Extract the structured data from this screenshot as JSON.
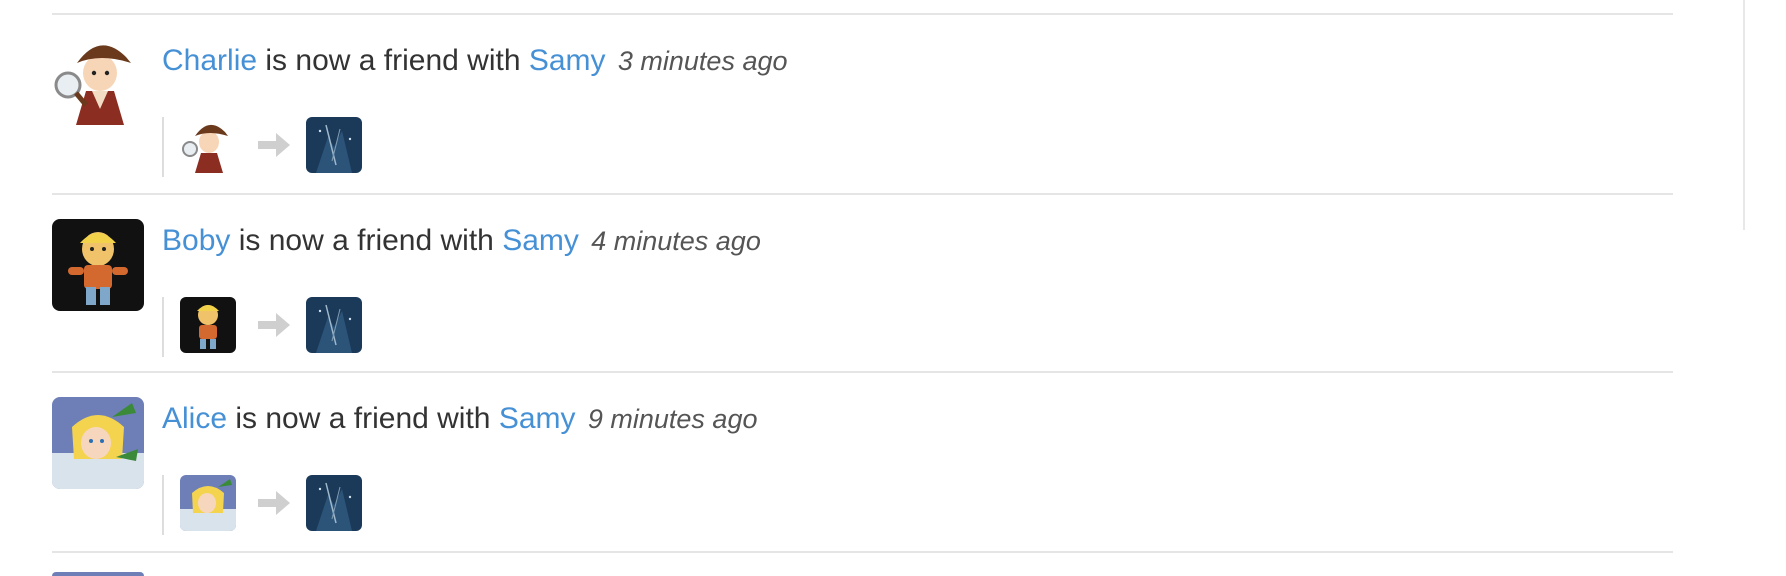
{
  "river": {
    "items": [
      {
        "subject": "Charlie",
        "action": "is now a friend with",
        "object": "Samy",
        "time": "3 minutes ago",
        "subject_icon": "detective-avatar",
        "object_icon": "night-scene-avatar"
      },
      {
        "subject": "Boby",
        "action": "is now a friend with",
        "object": "Samy",
        "time": "4 minutes ago",
        "subject_icon": "builder-figure-avatar",
        "object_icon": "night-scene-avatar"
      },
      {
        "subject": "Alice",
        "action": "is now a friend with",
        "object": "Samy",
        "time": "9 minutes ago",
        "subject_icon": "cartoon-girl-avatar",
        "object_icon": "night-scene-avatar"
      }
    ],
    "arrow_icon": "right-arrow-icon"
  }
}
